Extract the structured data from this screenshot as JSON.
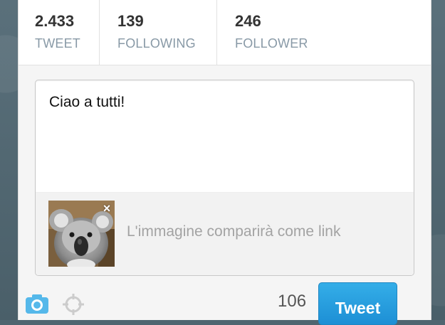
{
  "stats": [
    {
      "value": "2.433",
      "label": "TWEET"
    },
    {
      "value": "139",
      "label": "FOLLOWING"
    },
    {
      "value": "246",
      "label": "FOLLOWER"
    }
  ],
  "compose": {
    "text": "Ciao a tutti!",
    "attachment_note": "L'immagine comparirà come link",
    "remove_symbol": "×"
  },
  "toolbar": {
    "icons": [
      "camera-icon",
      "location-icon"
    ],
    "char_counter": "106",
    "tweet_label": "Tweet"
  },
  "colors": {
    "accent": "#2ba1e3",
    "muted_text": "#8899a6",
    "background": "#4f6570"
  }
}
